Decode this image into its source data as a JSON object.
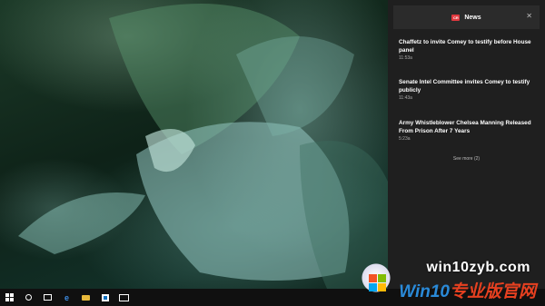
{
  "action_center": {
    "title": "News",
    "logo_text": "CR",
    "notifications": [
      {
        "headline": "Chaffetz to invite Comey to testify before House panel",
        "time": "11:53a"
      },
      {
        "headline": "Senate Intel Committee invites Comey to testify publicly",
        "time": "11:43a"
      },
      {
        "headline": "Army Whistleblower Chelsea Manning Released From Prison After 7 Years",
        "time": "5:23a"
      }
    ],
    "see_more": "See more (2)"
  },
  "taskbar": {
    "icons": [
      "start-icon",
      "cortana-icon",
      "task-view-icon",
      "edge-icon",
      "file-explorer-icon",
      "store-icon",
      "mail-icon"
    ]
  },
  "watermark": {
    "url": "win10zyb.com",
    "brand_part1": "Win10",
    "brand_part2": "专业版官网"
  },
  "colors": {
    "accent_news": "#e0383e",
    "panel_bg": "#1f1f1f",
    "taskbar_bg": "#101010"
  }
}
